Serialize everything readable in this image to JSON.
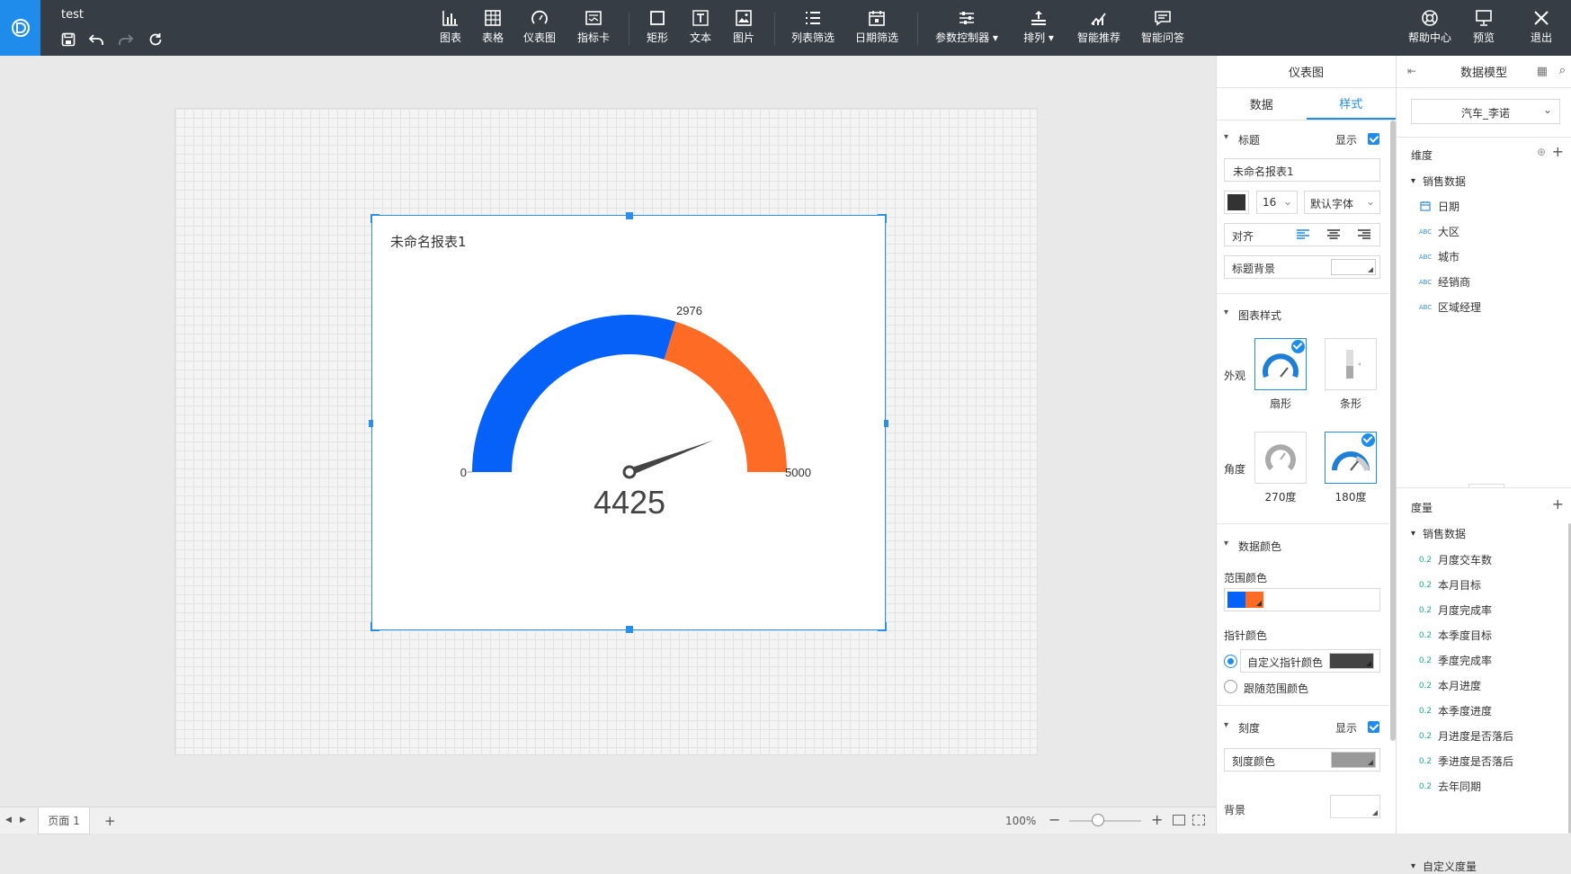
{
  "app": {
    "doc_title": "test"
  },
  "toolbar": {
    "items": [
      {
        "label": "图表",
        "icon": "bar-chart-icon"
      },
      {
        "label": "表格",
        "icon": "table-icon"
      },
      {
        "label": "仪表图",
        "icon": "gauge-icon"
      },
      {
        "label": "指标卡",
        "icon": "kpi-card-icon"
      },
      {
        "label": "矩形",
        "icon": "rectangle-icon"
      },
      {
        "label": "文本",
        "icon": "text-icon"
      },
      {
        "label": "图片",
        "icon": "image-icon"
      },
      {
        "label": "列表筛选",
        "icon": "list-filter-icon"
      },
      {
        "label": "日期筛选",
        "icon": "date-filter-icon"
      },
      {
        "label": "参数控制器",
        "icon": "sliders-icon"
      },
      {
        "label": "排列",
        "icon": "arrange-icon"
      },
      {
        "label": "智能推荐",
        "icon": "smart-chart-icon"
      },
      {
        "label": "智能问答",
        "icon": "chat-icon"
      }
    ],
    "right_items": [
      {
        "label": "帮助中心",
        "icon": "lifebuoy-icon"
      },
      {
        "label": "预览",
        "icon": "preview-icon"
      },
      {
        "label": "退出",
        "icon": "close-icon"
      }
    ]
  },
  "widget": {
    "title": "未命名报表1"
  },
  "gauge": {
    "min": 0,
    "max": 5000,
    "value": 4425,
    "threshold": 2976,
    "min_label": "0",
    "max_label": "5000",
    "threshold_label": "2976",
    "value_label": "4425",
    "colors": {
      "range1": "#0561f7",
      "range2": "#fe6b25",
      "needle": "#444444"
    }
  },
  "bottom": {
    "page_tab": "页面 1",
    "add": "+",
    "zoom": "100%",
    "zoom_fraction": 0.4
  },
  "props_panel": {
    "header": "仪表图",
    "tabs": [
      "数据",
      "样式"
    ],
    "active_tab": "样式",
    "title_section": {
      "label": "标题",
      "show_label": "显示",
      "title_value": "未命名报表1",
      "font_size": "16",
      "font_family": "默认字体",
      "align_label": "对齐",
      "bg_label": "标题背景",
      "color": "#333333"
    },
    "chart_style": {
      "label": "图表样式",
      "appearance_label": "外观",
      "options": [
        "扇形",
        "条形"
      ],
      "angle_label": "角度",
      "angles": [
        "270度",
        "180度"
      ]
    },
    "data_color": {
      "label": "数据颜色",
      "range_color_label": "范围颜色",
      "needle_color_label": "指针颜色",
      "custom_needle": "自定义指针颜色",
      "follow_range": "跟随范围颜色"
    },
    "scale": {
      "label": "刻度",
      "show_label": "显示",
      "color_label": "刻度颜色",
      "color": "#999999"
    },
    "background_label": "背景"
  },
  "model_panel": {
    "header": "数据模型",
    "dataset": "汽车_李诺",
    "dimensions_label": "维度",
    "dim_group": "销售数据",
    "dimensions": [
      {
        "type": "date",
        "name": "日期"
      },
      {
        "type": "ABC",
        "name": "大区"
      },
      {
        "type": "ABC",
        "name": "城市"
      },
      {
        "type": "ABC",
        "name": "经销商"
      },
      {
        "type": "ABC",
        "name": "区域经理"
      }
    ],
    "measures_label": "度量",
    "measure_group": "销售数据",
    "measures": [
      "月度交车数",
      "本月目标",
      "月度完成率",
      "本季度目标",
      "季度完成率",
      "本月进度",
      "本季度进度",
      "月进度是否落后",
      "季进度是否落后",
      "去年同期"
    ],
    "measure_tag": "0.2",
    "custom_measures": "自定义度量"
  }
}
